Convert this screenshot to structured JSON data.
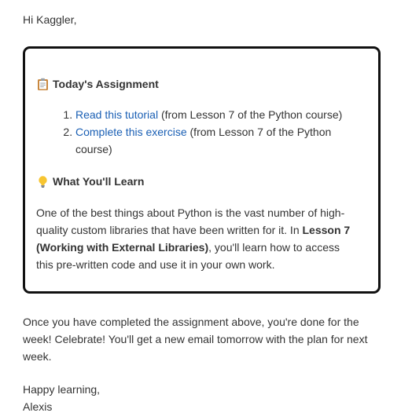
{
  "email": {
    "greeting": "Hi Kaggler,",
    "card": {
      "assignment_heading": "Today's Assignment",
      "assignment_icon": "clipboard-icon",
      "items": [
        {
          "link": "Read this tutorial",
          "rest": " (from Lesson 7 of the Python course)"
        },
        {
          "link": "Complete this exercise",
          "rest": " (from Lesson 7 of the Python course)"
        }
      ],
      "learn_heading": "What You'll Learn",
      "learn_icon": "lightbulb-icon",
      "para_part1": "One of the best things about Python is the vast number of high-quality custom libraries that have been written for it. In ",
      "para_bold": "Lesson 7 (Working with External Libraries)",
      "para_part2": ", you'll learn how to access this pre-written code and use it in your own work."
    },
    "outro": "Once you have completed the assignment above, you're done for the week! Celebrate! You'll get a new email tomorrow with the plan for next week.",
    "signoff_line1": "Happy learning,",
    "signoff_line2": "Alexis",
    "colors": {
      "link": "#1a5fb4",
      "text": "#333333",
      "border": "#111111"
    }
  }
}
